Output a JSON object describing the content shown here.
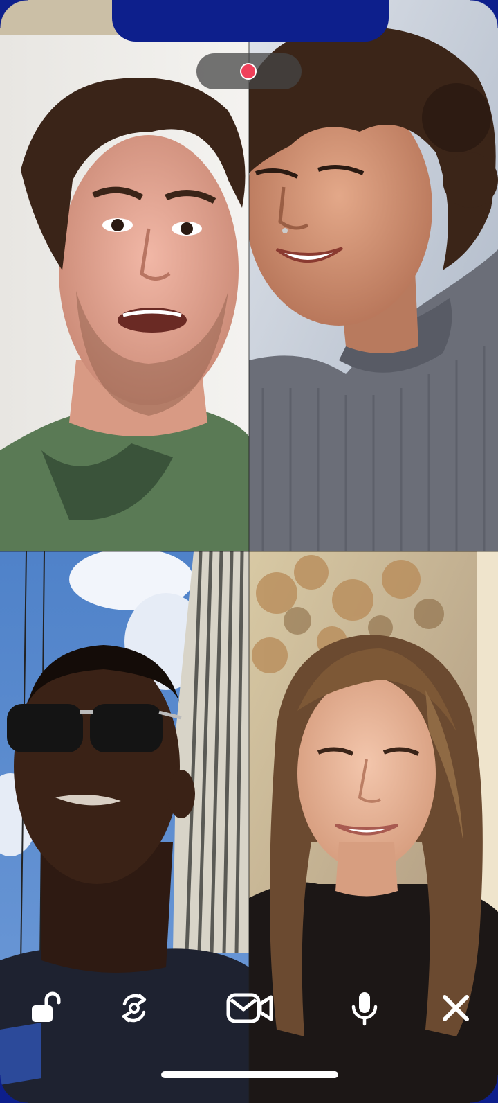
{
  "call": {
    "participants": [
      {
        "id": "participant-1"
      },
      {
        "id": "participant-2"
      },
      {
        "id": "participant-3"
      },
      {
        "id": "participant-4"
      }
    ],
    "recording": {
      "active": true,
      "color": "#f0405a"
    }
  },
  "toolbar": {
    "buttons": [
      {
        "icon": "unlock-icon"
      },
      {
        "icon": "flip-camera-icon"
      },
      {
        "icon": "message-video-icon"
      },
      {
        "icon": "microphone-icon"
      },
      {
        "icon": "close-icon"
      }
    ]
  },
  "colors": {
    "frame": "#0d1f8c",
    "icon": "#ffffff"
  }
}
